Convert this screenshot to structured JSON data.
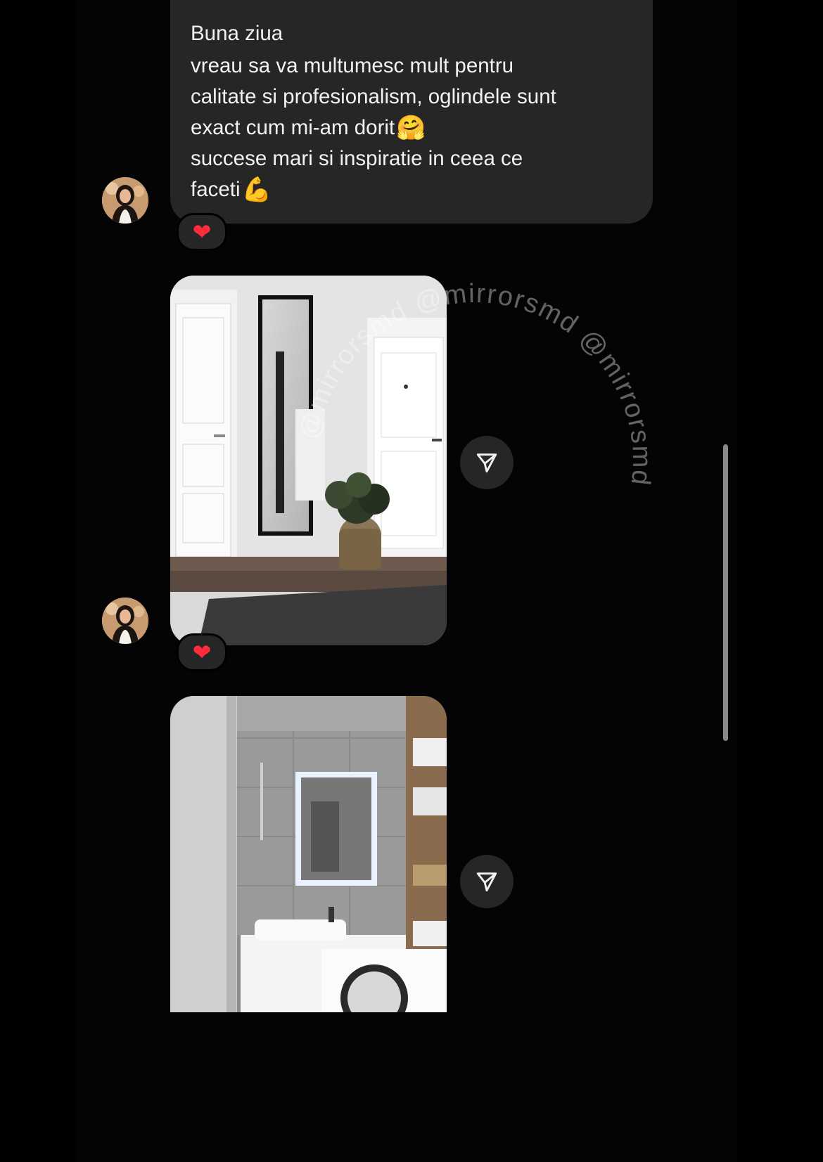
{
  "message": {
    "lines": [
      "Buna ziua",
      "vreau sa va multumesc mult pentru",
      "calitate si profesionalism, oglindele sunt",
      "exact cum mi-am dorit",
      "succese mari si inspiratie in ceea ce",
      "faceti"
    ],
    "emoji_hug": "🤗",
    "emoji_muscle": "💪"
  },
  "reactions": {
    "heart": "❤"
  },
  "watermark": {
    "text": "@mirrorsmd @mirrorsmd @mirrorsmd"
  },
  "icons": {
    "avatar": "avatar-icon",
    "share": "paper-plane-icon",
    "reaction": "heart-icon"
  },
  "colors": {
    "background": "#000000",
    "bubble": "#262626",
    "text": "#f2f2f2",
    "heart": "#ff2d3b",
    "scrollbar": "#8a8a8a"
  }
}
